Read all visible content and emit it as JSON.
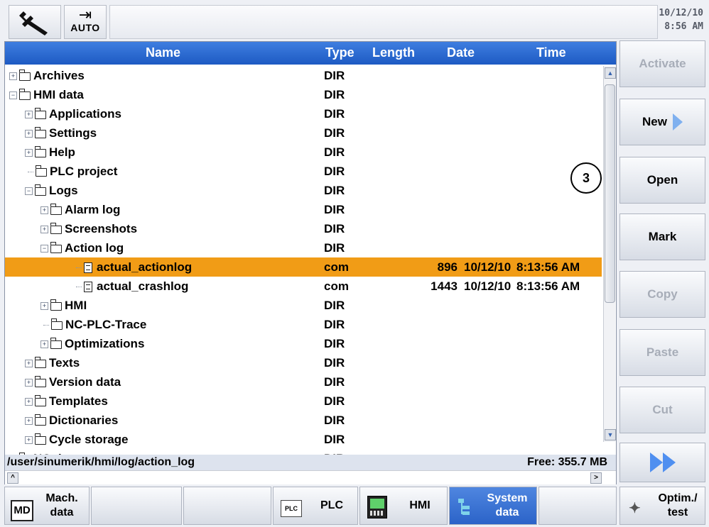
{
  "topbar": {
    "wrench_icon": "wrench-icon",
    "mode_label": "AUTO",
    "date": "10/12/10",
    "time": "8:56 AM"
  },
  "table": {
    "columns": [
      "Name",
      "Type",
      "Length",
      "Date",
      "Time"
    ],
    "rows": [
      {
        "name": "Archives",
        "type": "DIR",
        "length": "",
        "date": "",
        "time": ""
      },
      {
        "name": "HMI data",
        "type": "DIR",
        "length": "",
        "date": "",
        "time": ""
      },
      {
        "name": "Applications",
        "type": "DIR",
        "length": "",
        "date": "",
        "time": ""
      },
      {
        "name": "Settings",
        "type": "DIR",
        "length": "",
        "date": "",
        "time": ""
      },
      {
        "name": "Help",
        "type": "DIR",
        "length": "",
        "date": "",
        "time": ""
      },
      {
        "name": "PLC project",
        "type": "DIR",
        "length": "",
        "date": "",
        "time": ""
      },
      {
        "name": "Logs",
        "type": "DIR",
        "length": "",
        "date": "",
        "time": ""
      },
      {
        "name": "Alarm log",
        "type": "DIR",
        "length": "",
        "date": "",
        "time": ""
      },
      {
        "name": "Screenshots",
        "type": "DIR",
        "length": "",
        "date": "",
        "time": ""
      },
      {
        "name": "Action log",
        "type": "DIR",
        "length": "",
        "date": "",
        "time": ""
      },
      {
        "name": "actual_actionlog",
        "type": "com",
        "length": "896",
        "date": "10/12/10",
        "time": "8:13:56 AM"
      },
      {
        "name": "actual_crashlog",
        "type": "com",
        "length": "1443",
        "date": "10/12/10",
        "time": "8:13:56 AM"
      },
      {
        "name": "HMI",
        "type": "DIR",
        "length": "",
        "date": "",
        "time": ""
      },
      {
        "name": "NC-PLC-Trace",
        "type": "DIR",
        "length": "",
        "date": "",
        "time": ""
      },
      {
        "name": "Optimizations",
        "type": "DIR",
        "length": "",
        "date": "",
        "time": ""
      },
      {
        "name": "Texts",
        "type": "DIR",
        "length": "",
        "date": "",
        "time": ""
      },
      {
        "name": "Version data",
        "type": "DIR",
        "length": "",
        "date": "",
        "time": ""
      },
      {
        "name": "Templates",
        "type": "DIR",
        "length": "",
        "date": "",
        "time": ""
      },
      {
        "name": "Dictionaries",
        "type": "DIR",
        "length": "",
        "date": "",
        "time": ""
      },
      {
        "name": "Cycle storage",
        "type": "DIR",
        "length": "",
        "date": "",
        "time": ""
      },
      {
        "name": "NC data",
        "type": "DIR",
        "length": "",
        "date": "",
        "time": ""
      }
    ],
    "selected_row": "actual_actionlog"
  },
  "status": {
    "path": "/user/sinumerik/hmi/log/action_log",
    "free": "Free: 355.7 MB"
  },
  "callout": "3",
  "softkeys_right": [
    {
      "label": "Activate",
      "enabled": false
    },
    {
      "label": "New",
      "enabled": true
    },
    {
      "label": "Open",
      "enabled": true
    },
    {
      "label": "Mark",
      "enabled": true
    },
    {
      "label": "Copy",
      "enabled": false
    },
    {
      "label": "Paste",
      "enabled": false
    },
    {
      "label": "Cut",
      "enabled": false
    }
  ],
  "softkeys_bottom": [
    {
      "label": "Mach. data",
      "icon": "md-icon"
    },
    {
      "label": "PLC",
      "icon": "plc-icon"
    },
    {
      "label": "HMI",
      "icon": "hmi-icon"
    },
    {
      "label": "System data",
      "icon": "system-data-icon",
      "active": true
    },
    {
      "label": "Optim./ test",
      "icon": "optim-test-icon"
    }
  ],
  "colors": {
    "header_blue": "#2b63c8",
    "selection_orange": "#f19c16",
    "active_softkey": "#2b63c8"
  }
}
